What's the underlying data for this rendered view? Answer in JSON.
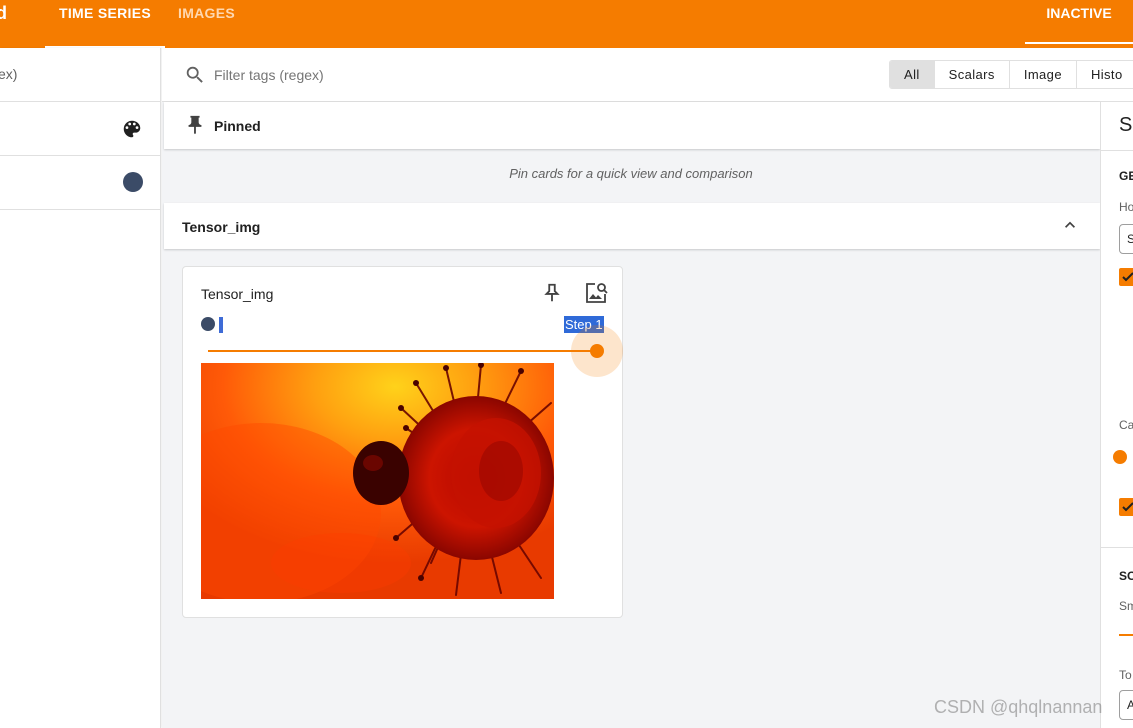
{
  "header": {
    "brand_fragment": "d",
    "tabs": [
      {
        "label": "TIME SERIES",
        "active": true
      },
      {
        "label": "IMAGES",
        "active": false
      }
    ],
    "status": "INACTIVE",
    "accent_color": "#f57c00"
  },
  "sidebar": {
    "filter_fragment": "ex)",
    "rows": [
      {
        "icon": "palette-icon"
      },
      {
        "icon": "run-color-dot",
        "color": "#3b4b67"
      }
    ]
  },
  "filter": {
    "placeholder": "Filter tags (regex)",
    "value": "",
    "chips": [
      "All",
      "Scalars",
      "Image",
      "Histo"
    ],
    "active_chip": "All"
  },
  "pinned": {
    "label": "Pinned",
    "empty_message": "Pin cards for a quick view and comparison"
  },
  "group": {
    "title": "Tensor_img",
    "expanded": true
  },
  "card": {
    "title": "Tensor_img",
    "run_marker": ".",
    "step_label": "Step 1",
    "slider_value": 1.0
  },
  "settings": {
    "title_fragment": "Se",
    "sections": [
      "GE",
      "SC"
    ],
    "labels": [
      "Ho",
      "Ca",
      "Sm",
      "To"
    ],
    "select_values": [
      "S",
      "A"
    ]
  },
  "watermark": "CSDN @qhqlnannan"
}
